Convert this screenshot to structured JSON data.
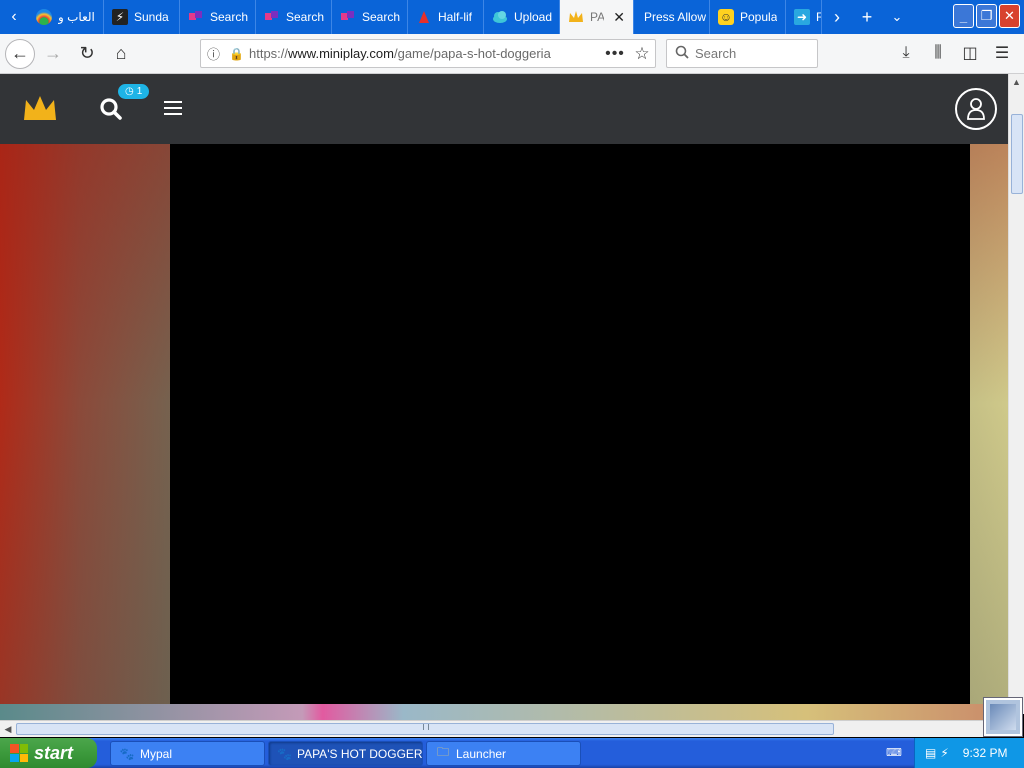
{
  "browser": {
    "tabs": [
      {
        "label": "العاب و",
        "icon": "rainbow-icon"
      },
      {
        "label": "Sunda",
        "icon": "sunday-icon"
      },
      {
        "label": "Search",
        "icon": "search-tab-icon"
      },
      {
        "label": "Search",
        "icon": "search-tab-icon"
      },
      {
        "label": "Search",
        "icon": "search-tab-icon"
      },
      {
        "label": "Half-lif",
        "icon": "half-life-icon"
      },
      {
        "label": "Upload",
        "icon": "cloud-upload-icon"
      },
      {
        "label": "PAPA'S HOT DOGGERIA",
        "icon": "crown-icon",
        "active": true
      },
      {
        "label": "Press Allow",
        "icon": ""
      },
      {
        "label": "Popula",
        "icon": "smiley-icon"
      },
      {
        "label": "F",
        "icon": "arrow-box-icon"
      }
    ],
    "url": "https://www.miniplay.com/game/papa-s-hot-doggeria",
    "url_host": "www.miniplay.com",
    "url_prefix": "https://",
    "url_path": "/game/papa-s-hot-doggeria",
    "search_placeholder": "Search",
    "colors": {
      "tabbar": "#0a64d8",
      "toolbar": "#f5f6f7"
    }
  },
  "site": {
    "notification_count": "1",
    "colors": {
      "header": "#323437",
      "badge": "#1eb4e6",
      "crown": "#f2b21a"
    }
  },
  "taskbar": {
    "start_label": "start",
    "tasks": [
      {
        "label": "Mypal",
        "active": false
      },
      {
        "label": "PAPA'S HOT DOGGER...",
        "active": true
      },
      {
        "label": "Launcher",
        "active": false
      }
    ],
    "clock": "9:32 PM"
  }
}
